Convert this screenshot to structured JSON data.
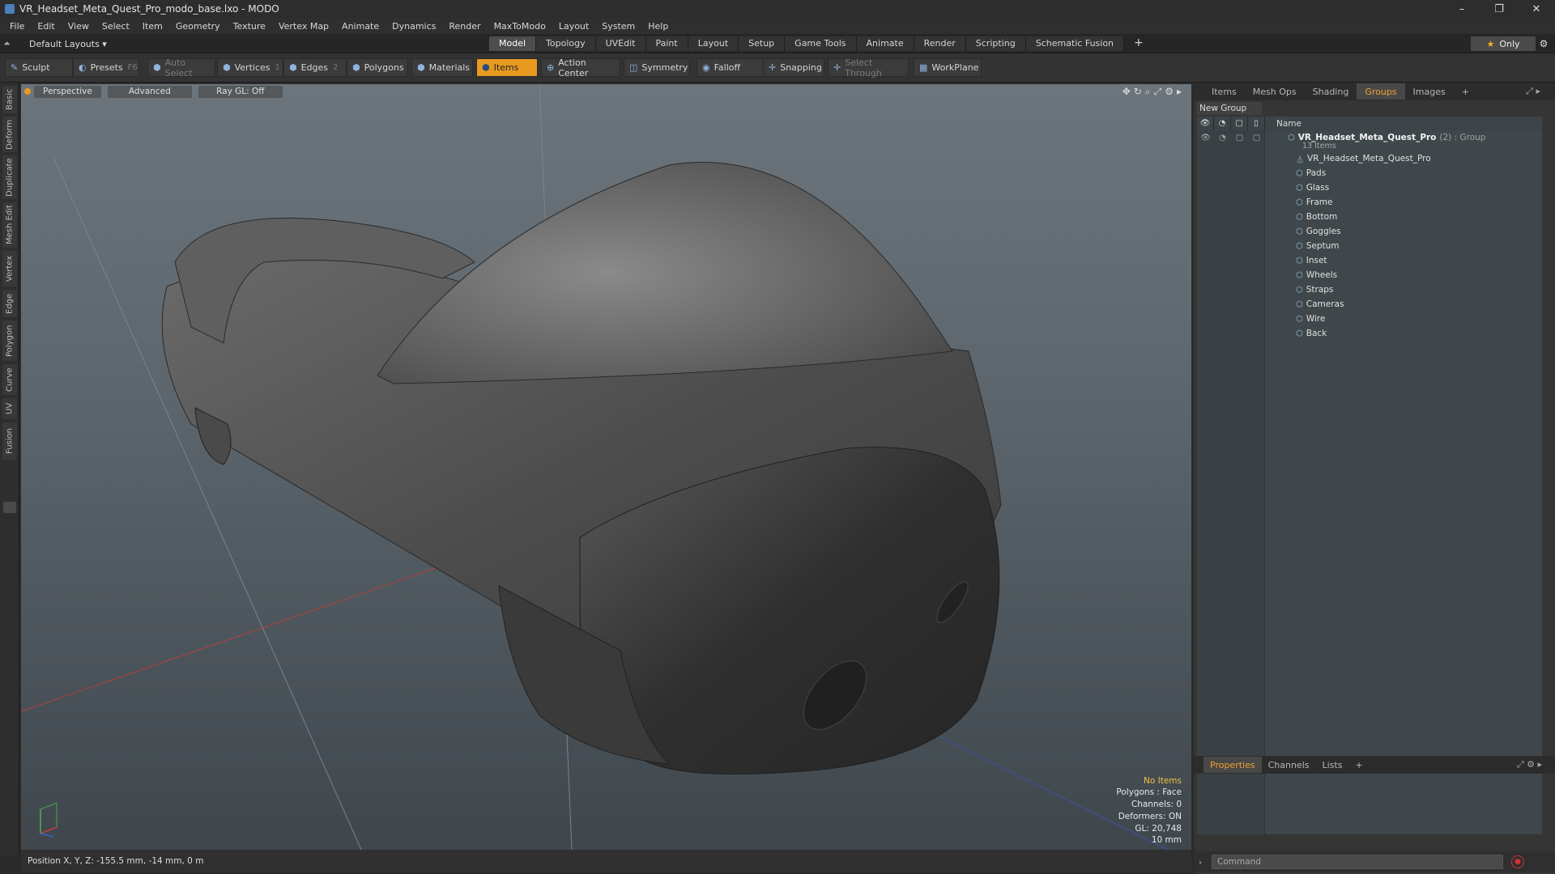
{
  "window": {
    "title": "VR_Headset_Meta_Quest_Pro_modo_base.lxo - MODO",
    "minimize": "–",
    "maximize": "❐",
    "close": "✕"
  },
  "menu": [
    "File",
    "Edit",
    "View",
    "Select",
    "Item",
    "Geometry",
    "Texture",
    "Vertex Map",
    "Animate",
    "Dynamics",
    "Render",
    "MaxToModo",
    "Layout",
    "System",
    "Help"
  ],
  "layouts": {
    "label": "Default Layouts ▾"
  },
  "mode_tabs": [
    "Model",
    "Topology",
    "UVEdit",
    "Paint",
    "Layout",
    "Setup",
    "Game Tools",
    "Animate",
    "Render",
    "Scripting",
    "Schematic Fusion"
  ],
  "mode_active": "Model",
  "mode_add": "+",
  "only_label": "Only",
  "toolbar": {
    "sculpt": "Sculpt",
    "presets": "Presets",
    "presets_key": "F6",
    "auto_select": "Auto Select",
    "vertices": "Vertices",
    "vertices_key": "1",
    "edges": "Edges",
    "edges_key": "2",
    "polygons": "Polygons",
    "materials": "Materials",
    "items": "Items",
    "action_center": "Action Center",
    "symmetry": "Symmetry",
    "falloff": "Falloff",
    "snapping": "Snapping",
    "select_through": "Select Through",
    "workplane": "WorkPlane"
  },
  "left_tabs": [
    "Basic",
    "Deform",
    "Duplicate",
    "Mesh Edit",
    "Vertex",
    "Edge",
    "Polygon",
    "Curve",
    "UV",
    "Fusion"
  ],
  "viewport": {
    "view": "Perspective",
    "shading": "Advanced",
    "raygl": "Ray GL: Off",
    "info": {
      "selection": "No Items",
      "polygons": "Polygons : Face",
      "channels": "Channels: 0",
      "deformers": "Deformers: ON",
      "gl": "GL: 20,748",
      "scale": "10 mm"
    }
  },
  "status": {
    "position": "Position X, Y, Z:  -155.5 mm, -14 mm, 0 m"
  },
  "right_tabs": [
    "Items",
    "Mesh Ops",
    "Shading",
    "Groups",
    "Images"
  ],
  "right_active": "Groups",
  "right_add": "+",
  "groups": {
    "new_group": "New Group",
    "col_name": "Name",
    "root": {
      "name": "VR_Headset_Meta_Quest_Pro",
      "suffix": "(2) : Group",
      "count": "13 Items"
    },
    "items": [
      "VR_Headset_Meta_Quest_Pro",
      "Pads",
      "Glass",
      "Frame",
      "Bottom",
      "Goggles",
      "Septum",
      "Inset",
      "Wheels",
      "Straps",
      "Cameras",
      "Wire",
      "Back"
    ]
  },
  "bottom_tabs": [
    "Properties",
    "Channels",
    "Lists"
  ],
  "bottom_active": "Properties",
  "bottom_add": "+",
  "command": {
    "placeholder": "Command"
  }
}
